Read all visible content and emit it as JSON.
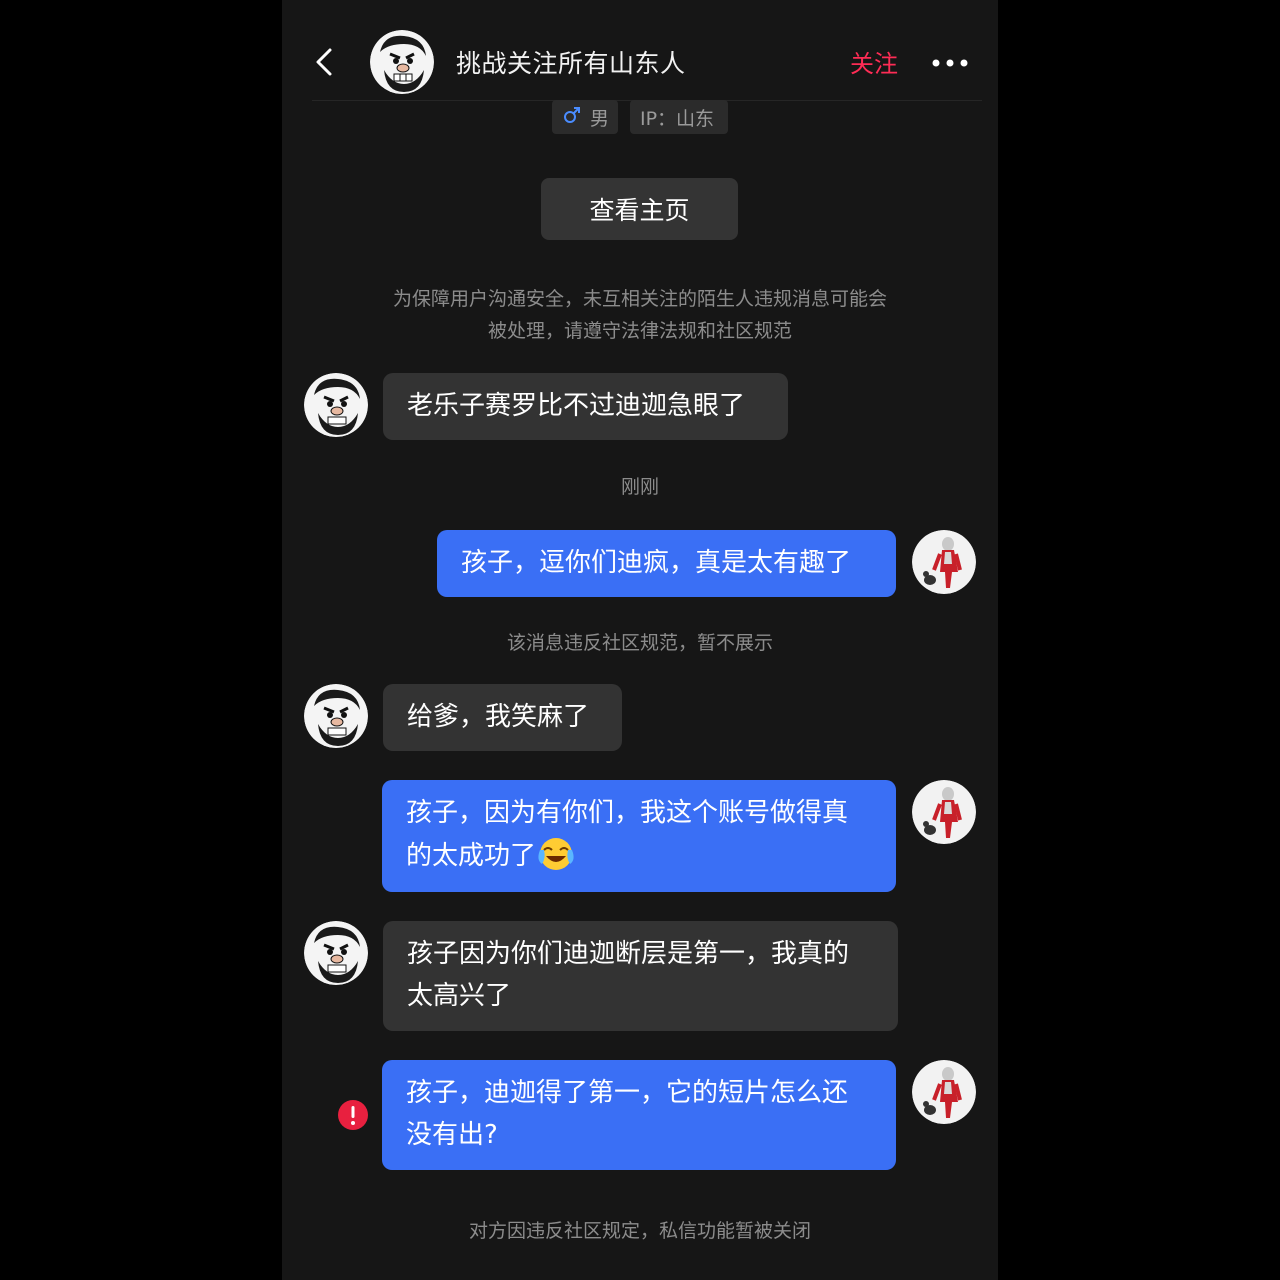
{
  "header": {
    "title": "挑战关注所有山东人",
    "follow_label": "关注",
    "back_icon": "back-chevron-icon",
    "more_icon": "more-dots-icon"
  },
  "profile_tags": {
    "gender_symbol": "♂",
    "gender_label": "男",
    "ip_label": "IP：山东"
  },
  "view_profile_label": "查看主页",
  "notice": {
    "line1": "为保障用户沟通安全，未互相关注的陌生人违规消息可能会",
    "line2": "被处理，请遵守法律法规和社区规范"
  },
  "messages": [
    {
      "side": "in",
      "text": "老乐子赛罗比不过迪迦急眼了"
    },
    {
      "side": "meta",
      "text": "刚刚"
    },
    {
      "side": "out",
      "text": "孩子，逗你们迪疯，真是太有趣了"
    },
    {
      "side": "meta",
      "text": "该消息违反社区规范，暂不展示"
    },
    {
      "side": "in",
      "text": "给爹，我笑麻了"
    },
    {
      "side": "out",
      "line1": "孩子，因为有你们，我这个账号做得真",
      "line2": "的太成功了",
      "emoji": "laughing-crying-emoji"
    },
    {
      "side": "in",
      "line1": "孩子因为你们迪迦断层是第一，我真的",
      "line2": "太高兴了"
    },
    {
      "side": "out",
      "line1": "孩子，迪迦得了第一，它的短片怎么还",
      "line2": "没有出?",
      "status": "failed"
    }
  ],
  "footer_notice": "对方因违反社区规定，私信功能暂被关闭",
  "colors": {
    "background": "#161616",
    "incoming_bubble": "#333333",
    "outgoing_bubble": "#3a6ff5",
    "follow_red": "#fe2c55",
    "error_red": "#e8203f",
    "muted_text": "#8c8c8c"
  }
}
